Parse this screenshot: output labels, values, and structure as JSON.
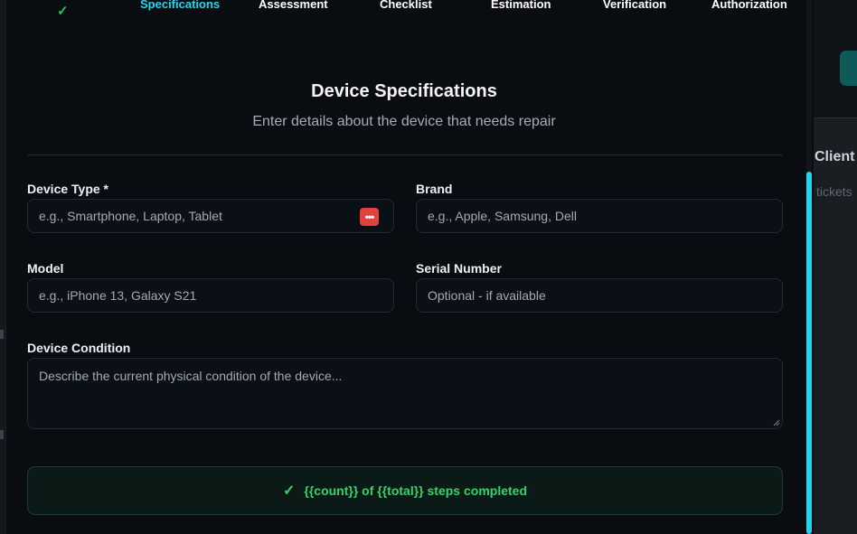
{
  "background": {
    "label": "Client",
    "sub": "tickets"
  },
  "steps": {
    "completed_icon": "check-icon",
    "items": [
      {
        "label": "Specifications",
        "state": "active"
      },
      {
        "label": "Assessment",
        "state": "upcoming"
      },
      {
        "label": "Checklist",
        "state": "upcoming"
      },
      {
        "label": "Estimation",
        "state": "upcoming"
      },
      {
        "label": "Verification",
        "state": "upcoming"
      },
      {
        "label": "Authorization",
        "state": "upcoming"
      }
    ]
  },
  "form": {
    "title": "Device Specifications",
    "subtitle": "Enter details about the device that needs repair",
    "device_type": {
      "label": "Device Type *",
      "placeholder": "e.g., Smartphone, Laptop, Tablet",
      "value": ""
    },
    "brand": {
      "label": "Brand",
      "placeholder": "e.g., Apple, Samsung, Dell",
      "value": ""
    },
    "model": {
      "label": "Model",
      "placeholder": "e.g., iPhone 13, Galaxy S21",
      "value": ""
    },
    "serial": {
      "label": "Serial Number",
      "placeholder": "Optional - if available",
      "value": ""
    },
    "condition": {
      "label": "Device Condition",
      "placeholder": "Describe the current physical condition of the device...",
      "value": ""
    }
  },
  "progress": {
    "text": "{{count}} of {{total}} steps completed",
    "icon": "check-icon"
  },
  "colors": {
    "accent": "#22d3ee",
    "success": "#34d36a",
    "danger": "#e0423d",
    "modal_bg": "#090d12"
  }
}
